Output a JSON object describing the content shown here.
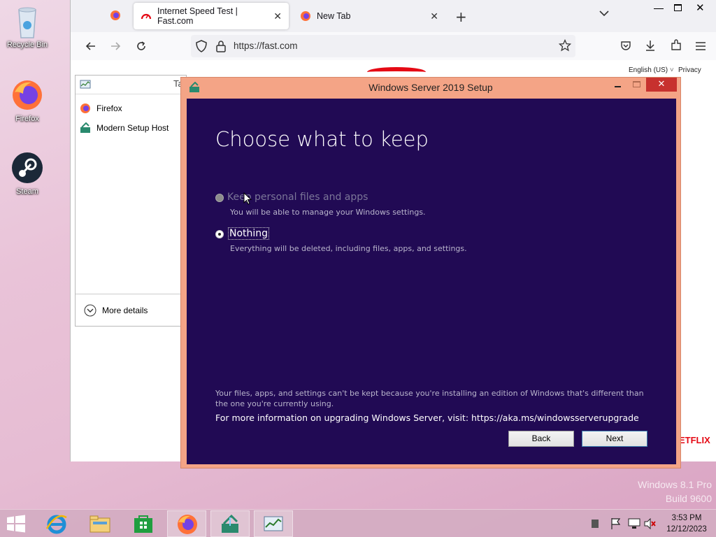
{
  "desktop": {
    "icons": [
      {
        "label": "Recycle Bin"
      },
      {
        "label": "Firefox"
      },
      {
        "label": "Steam"
      }
    ],
    "watermark": {
      "line1": "Windows 8.1 Pro",
      "line2": "Build 9600"
    }
  },
  "browser": {
    "tabs": [
      {
        "label": "Internet Speed Test | Fast.com"
      },
      {
        "label": "New Tab"
      }
    ],
    "url": "https://fast.com",
    "page": {
      "language": "English (US)",
      "privacy": "Privacy",
      "netflix": "ETFLIX"
    }
  },
  "taskmgr": {
    "title_fragment": "Ta",
    "items": [
      {
        "label": "Firefox"
      },
      {
        "label": "Modern Setup Host"
      }
    ],
    "more_details": "More details"
  },
  "setup": {
    "title": "Windows Server 2019 Setup",
    "heading": "Choose what to keep",
    "options": [
      {
        "label": "Keep personal files and apps",
        "desc": "You will be able to manage your Windows settings.",
        "enabled": false
      },
      {
        "label": "Nothing",
        "desc": "Everything will be deleted, including files, apps, and settings.",
        "enabled": true,
        "selected": true
      }
    ],
    "info": "Your files, apps, and settings can't be kept because you're installing an edition of Windows that's different than the one you're currently using.",
    "more_info": "For more information on upgrading Windows Server, visit: https://aka.ms/windowsserverupgrade",
    "back": "Back",
    "next": "Next"
  },
  "taskbar": {
    "time": "3:53 PM",
    "date": "12/12/2023"
  }
}
